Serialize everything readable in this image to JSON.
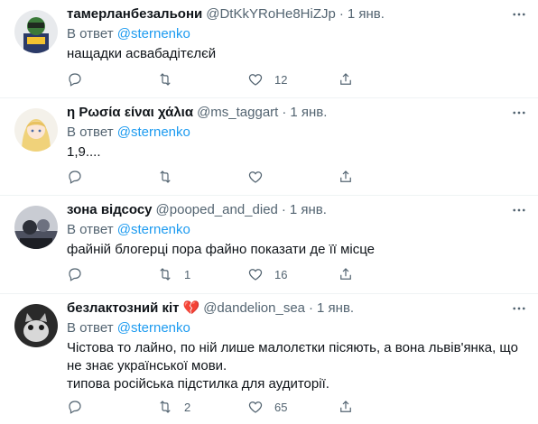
{
  "tweets": [
    {
      "name": "тамерланбезальони",
      "handle": "@DtKkYRoHe8HiZJp",
      "separator": "·",
      "time": "1 янв.",
      "reply_prefix": "В ответ",
      "reply_to": "@sternenko",
      "text": "нащадки асвабадітєлєй",
      "replies": "",
      "retweets": "",
      "likes": "12"
    },
    {
      "name": "η Ρωσία είναι χάλια",
      "handle": "@ms_taggart",
      "separator": "·",
      "time": "1 янв.",
      "reply_prefix": "В ответ",
      "reply_to": "@sternenko",
      "text": "1,9....",
      "replies": "",
      "retweets": "",
      "likes": ""
    },
    {
      "name": "зона відсосу",
      "handle": "@pooped_and_died",
      "separator": "·",
      "time": "1 янв.",
      "reply_prefix": "В ответ",
      "reply_to": "@sternenko",
      "text": "файній блогерці пора файно показати де її місце",
      "replies": "",
      "retweets": "1",
      "likes": "16"
    },
    {
      "name": "безлактозний кіт",
      "name_emoji": "💔",
      "handle": "@dandelion_sea",
      "separator": "·",
      "time": "1 янв.",
      "reply_prefix": "В ответ",
      "reply_to": "@sternenko",
      "text": "Чістова то лайно, по ній лише малолєтки пісяють, а вона львів'янка, що\nне знає української мови.\nтипова російська підстилка для аудиторії.",
      "replies": "",
      "retweets": "2",
      "likes": "65"
    }
  ],
  "icons": {
    "reply": "reply-icon",
    "retweet": "retweet-icon",
    "like": "like-icon",
    "share": "share-icon",
    "more": "more-icon"
  },
  "colors": {
    "link": "#1d9bf0",
    "secondary_text": "#536471",
    "divider": "#eff3f4"
  }
}
